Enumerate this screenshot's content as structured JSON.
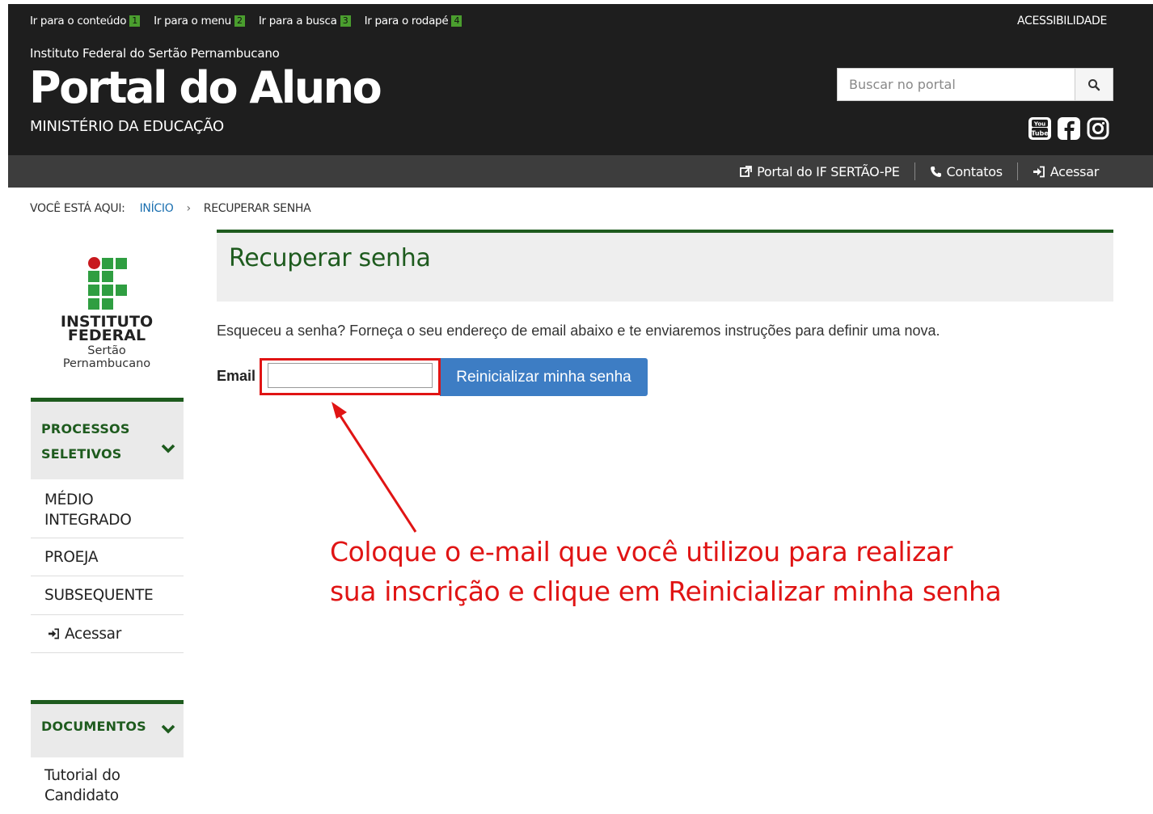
{
  "accessibility_links": [
    {
      "label": "Ir para o conteúdo",
      "key": "1"
    },
    {
      "label": "Ir para o menu",
      "key": "2"
    },
    {
      "label": "Ir para a busca",
      "key": "3"
    },
    {
      "label": "Ir para o rodapé",
      "key": "4"
    }
  ],
  "header": {
    "accessibility_label": "ACESSIBILIDADE",
    "institution": "Instituto Federal do Sertão Pernambucano",
    "portal_title": "Portal do Aluno",
    "ministry": "MINISTÉRIO DA EDUCAÇÃO",
    "search_placeholder": "Buscar no portal",
    "social_icons": [
      "youtube-icon",
      "facebook-icon",
      "instagram-icon"
    ]
  },
  "navbar": {
    "portal_link": "Portal do IF SERTÃO-PE",
    "contacts": "Contatos",
    "login": "Acessar"
  },
  "breadcrumb": {
    "prefix": "VOCÊ ESTÁ AQUI:",
    "home": "INÍCIO",
    "current": "RECUPERAR SENHA"
  },
  "logo": {
    "line1": "INSTITUTO",
    "line2": "FEDERAL",
    "line3": "Sertão Pernambucano"
  },
  "sidebar": {
    "processos": {
      "title_line1": "PROCESSOS",
      "title_line2": "SELETIVOS",
      "items": [
        {
          "line1": "MÉDIO",
          "line2": "INTEGRADO"
        },
        {
          "line1": "PROEJA"
        },
        {
          "line1": "SUBSEQUENTE"
        },
        {
          "line1": "Acessar"
        }
      ]
    },
    "documentos": {
      "title": "DOCUMENTOS",
      "items": [
        {
          "line1": "Tutorial do",
          "line2": "Candidato"
        }
      ]
    }
  },
  "main": {
    "title": "Recuperar senha",
    "description": "Esqueceu a senha? Forneça o seu endereço de email abaixo e te enviaremos instruções para definir uma nova.",
    "email_label": "Email",
    "email_value": "",
    "reset_button": "Reinicializar minha senha"
  },
  "annotation": {
    "line1": "Coloque o e-mail que você utilizou para realizar",
    "line2": "sua inscrição e clique em Reinicializar minha senha",
    "color": "#e01414"
  },
  "colors": {
    "header_bg": "#1e1e1e",
    "navbar_bg": "#3d3d3d",
    "brand_green": "#1e5b1e",
    "button_blue": "#3d7dc4"
  }
}
